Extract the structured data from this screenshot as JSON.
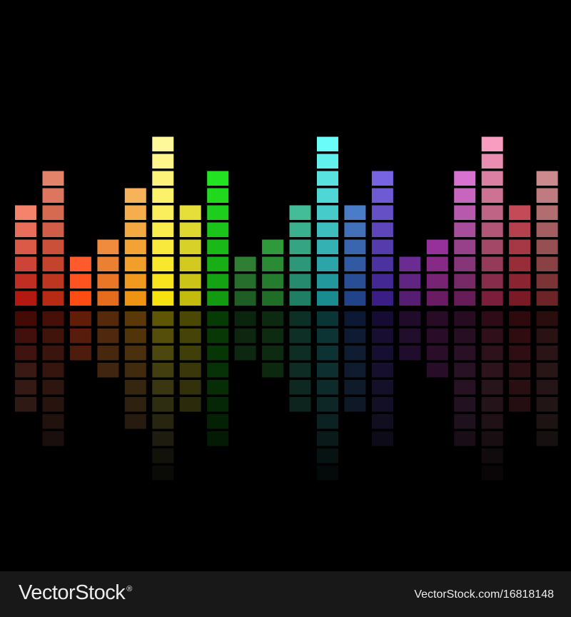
{
  "equalizer": {
    "bars": [
      {
        "segments": 6,
        "top": "#f5836c",
        "bottom": "#b31910"
      },
      {
        "segments": 8,
        "top": "#e3836a",
        "bottom": "#b72a14"
      },
      {
        "segments": 3,
        "top": "#ff5a2b",
        "bottom": "#ff4c12"
      },
      {
        "segments": 4,
        "top": "#f08a3c",
        "bottom": "#e56b1d"
      },
      {
        "segments": 7,
        "top": "#f7b25a",
        "bottom": "#ef9412"
      },
      {
        "segments": 10,
        "top": "#fff89a",
        "bottom": "#f6e20e"
      },
      {
        "segments": 6,
        "top": "#e6df3a",
        "bottom": "#c4bc0c"
      },
      {
        "segments": 8,
        "top": "#22e322",
        "bottom": "#129a10"
      },
      {
        "segments": 3,
        "top": "#2e7e34",
        "bottom": "#1e5e24"
      },
      {
        "segments": 4,
        "top": "#2e9a3a",
        "bottom": "#1f6e28"
      },
      {
        "segments": 6,
        "top": "#42bd98",
        "bottom": "#1f7e64"
      },
      {
        "segments": 10,
        "top": "#6afcf8",
        "bottom": "#198c90"
      },
      {
        "segments": 6,
        "top": "#4a7dc8",
        "bottom": "#22428a"
      },
      {
        "segments": 8,
        "top": "#7764e0",
        "bottom": "#3a1e86"
      },
      {
        "segments": 3,
        "top": "#6a2c92",
        "bottom": "#561e72"
      },
      {
        "segments": 4,
        "top": "#96309a",
        "bottom": "#6a1c62"
      },
      {
        "segments": 8,
        "top": "#d872d0",
        "bottom": "#661c56"
      },
      {
        "segments": 10,
        "top": "#f89cc0",
        "bottom": "#7a1e3c"
      },
      {
        "segments": 6,
        "top": "#c44a58",
        "bottom": "#7a1a26"
      },
      {
        "segments": 8,
        "top": "#cc8a8e",
        "bottom": "#6e2426"
      }
    ]
  },
  "footer": {
    "brand": "VectorStock",
    "registered": "®",
    "image_id": "VectorStock.com/16818148"
  },
  "colors": {
    "background": "#000000",
    "footer_background": "#181818",
    "footer_text": "#ececec"
  }
}
